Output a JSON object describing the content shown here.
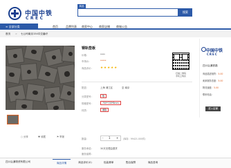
{
  "header": {
    "logo_cn": "中国中铁",
    "logo_en": "CREC",
    "search_tab": "商品",
    "search_button": "搜索"
  },
  "nav": {
    "category_label": "全部分类",
    "items": [
      "首页",
      "品牌列表",
      "商家中心",
      "商家店铺",
      "商城公告"
    ]
  },
  "breadcrumb": {
    "home": "首页",
    "separator": ">",
    "store": "七公司南京154中交番纡"
  },
  "product": {
    "title": "钢轨垫板",
    "price_label": "价格：",
    "price_value": "****",
    "market_label": "市场价：",
    "market_value": "*****",
    "rating_label": "商品评价：",
    "stars": "★★★★★",
    "qr_caption": "扫描二维码\n手机上购买",
    "ship_label": "配送：",
    "ship_from": "上海 浦江区",
    "ship_to": "至 南京",
    "spec_type_label": "分类型号：",
    "spec_type_value": "板",
    "spec_size_label": "规格型号：",
    "spec_size_value": "700*700*8mm",
    "spec_material_label": "材质：",
    "spec_material_value": "面板",
    "qty_label": "数量：",
    "qty_minus": "-",
    "qty_value": "1",
    "qty_plus": "+",
    "stock_text": "(库存：99421.000件)",
    "service_label": "服务承诺：",
    "service_value": "30天无理由退货",
    "guarantee_label": "服务保障："
  },
  "gallery": {
    "share": "分享",
    "favorite": "收藏",
    "report": "举报"
  },
  "store_panel": {
    "logo_cn": "中国中铁",
    "logo_en": "CREC",
    "name": "四川弘通铁路",
    "rows": [
      {
        "label": "商品描述相符：",
        "value": "5.00"
      },
      {
        "label": "卖家服务态度：",
        "value": "5.00"
      },
      {
        "label": "物流速度：",
        "value": "5.00"
      },
      {
        "label": "联系电话：",
        "value": ""
      }
    ],
    "enter_button": "进入店铺"
  },
  "bottom": {
    "store_name": "四川弘通物资有限公司",
    "tabs": [
      "商品详情",
      "商品评价(0)",
      "包装清单",
      "售后保障",
      "商品咨询"
    ]
  },
  "colors": {
    "brand": "#2c5aa8",
    "accent": "#e06020"
  }
}
